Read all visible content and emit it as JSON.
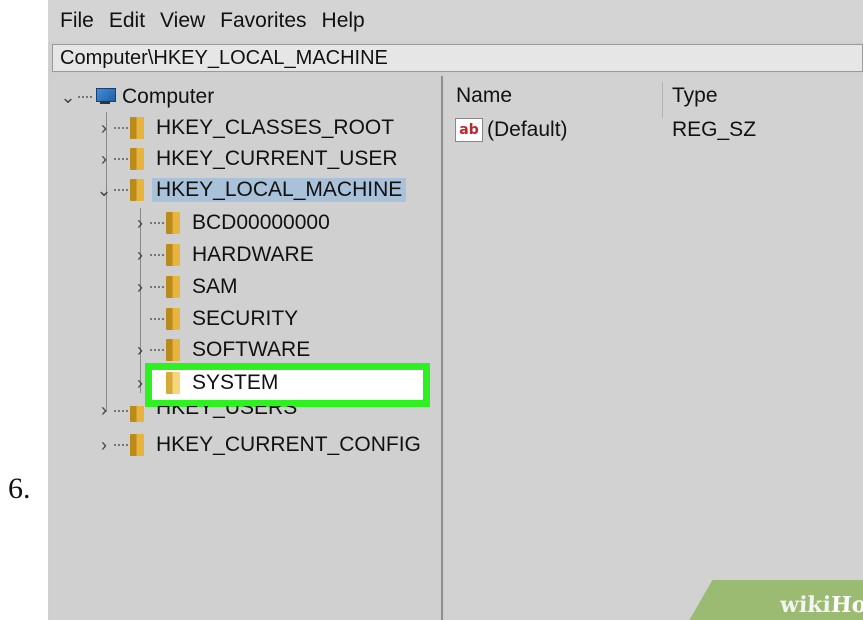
{
  "step_number": "6.",
  "menu": [
    "File",
    "Edit",
    "View",
    "Favorites",
    "Help"
  ],
  "address": "Computer\\HKEY_LOCAL_MACHINE",
  "tree": {
    "root": "Computer",
    "hives": [
      "HKEY_CLASSES_ROOT",
      "HKEY_CURRENT_USER",
      "HKEY_LOCAL_MACHINE",
      "HKEY_USERS",
      "HKEY_CURRENT_CONFIG"
    ],
    "subkeys": [
      "BCD00000000",
      "HARDWARE",
      "SAM",
      "SECURITY",
      "SOFTWARE",
      "SYSTEM"
    ],
    "selected": "HKEY_LOCAL_MACHINE",
    "highlighted": "SYSTEM"
  },
  "list": {
    "columns": [
      "Name",
      "Type"
    ],
    "rows": [
      {
        "name": "(Default)",
        "type": "REG_SZ",
        "icon": "string-value-icon",
        "icon_text": "ab"
      }
    ]
  },
  "watermark": {
    "part1": "wiki",
    "part2": "How"
  },
  "colors": {
    "highlight": "#2ef21f",
    "selection": "#a9c1d9",
    "watermark": "#9bbb73"
  }
}
